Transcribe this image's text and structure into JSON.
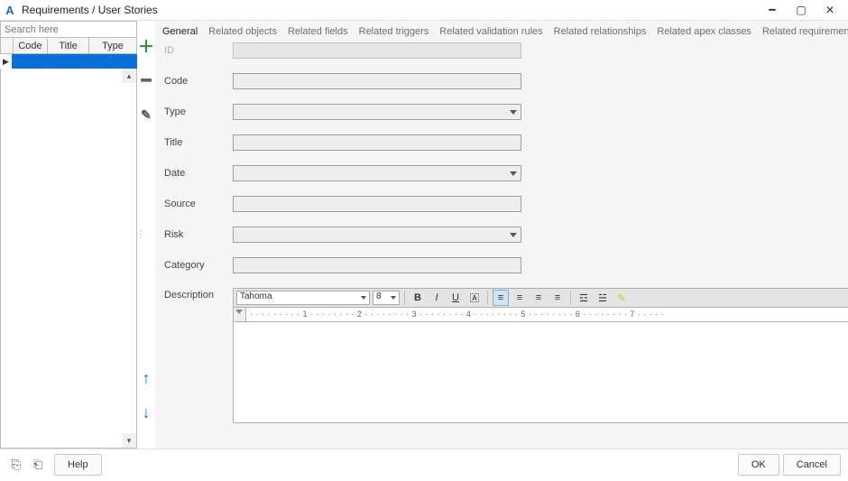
{
  "window": {
    "title": "Requirements / User Stories"
  },
  "search": {
    "placeholder": "Search here"
  },
  "table": {
    "headers": {
      "code": "Code",
      "title": "Title",
      "type": "Type"
    },
    "row_marker": "▶"
  },
  "tools": {
    "add": "＋",
    "remove": "━",
    "edit": "✎",
    "up": "↑",
    "down": "↓"
  },
  "tabs": {
    "general": "General",
    "related_objects": "Related objects",
    "related_fields": "Related fields",
    "related_triggers": "Related triggers",
    "related_validation": "Related validation rules",
    "related_relations": "Related relationships",
    "related_apex": "Related apex classes",
    "related_reqs": "Related requirements / user stories"
  },
  "fields": {
    "id": "ID",
    "code": "Code",
    "type": "Type",
    "title": "Title",
    "date": "Date",
    "source": "Source",
    "risk": "Risk",
    "category": "Category",
    "description": "Description"
  },
  "editor": {
    "font_name": "Tahoma",
    "font_size": "8",
    "ruler": "· · · · · · · · · 1 · · · · · · · · 2 · · · · · · · · 3 · · · · · · · · 4 · · · · · · · · 5 · · · · · · · · 6 · · · · · · · · 7 · · · · ·"
  },
  "footer": {
    "help": "Help",
    "ok": "OK",
    "cancel": "Cancel"
  }
}
